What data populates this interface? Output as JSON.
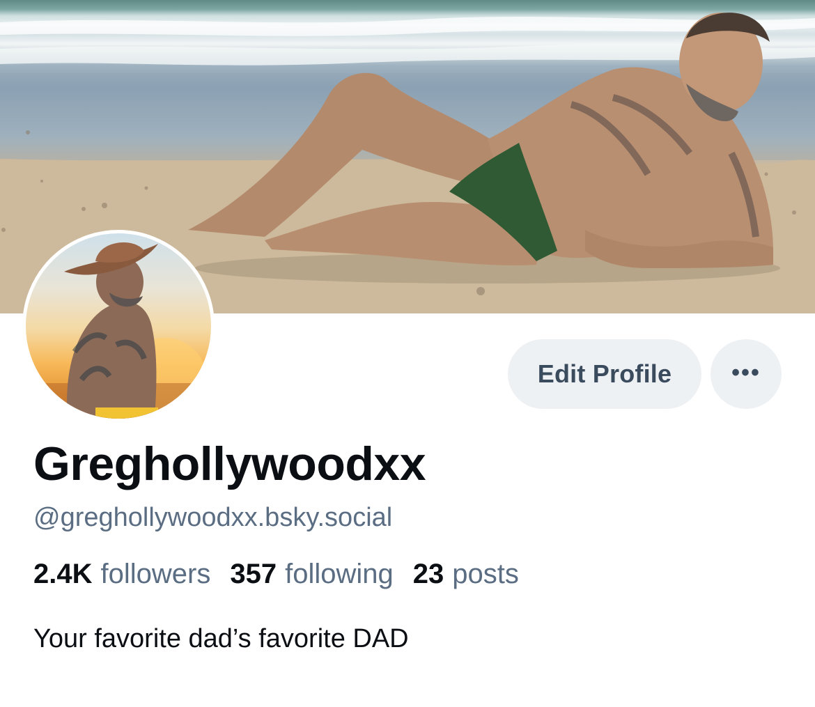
{
  "profile": {
    "display_name": "Greghollywoodxx",
    "handle": "@greghollywoodxx.bsky.social",
    "bio": "Your favorite dad’s favorite DAD",
    "stats": {
      "followers_count": "2.4K",
      "followers_label": "followers",
      "following_count": "357",
      "following_label": "following",
      "posts_count": "23",
      "posts_label": "posts"
    }
  },
  "actions": {
    "edit_profile_label": "Edit Profile",
    "more_label": "•••"
  },
  "icons": {
    "more": "more-horizontal-icon"
  },
  "colors": {
    "button_bg": "#eef1f4",
    "button_text": "#3b4b5e",
    "muted_text": "#5a6d82",
    "primary_text": "#0b0f14"
  }
}
